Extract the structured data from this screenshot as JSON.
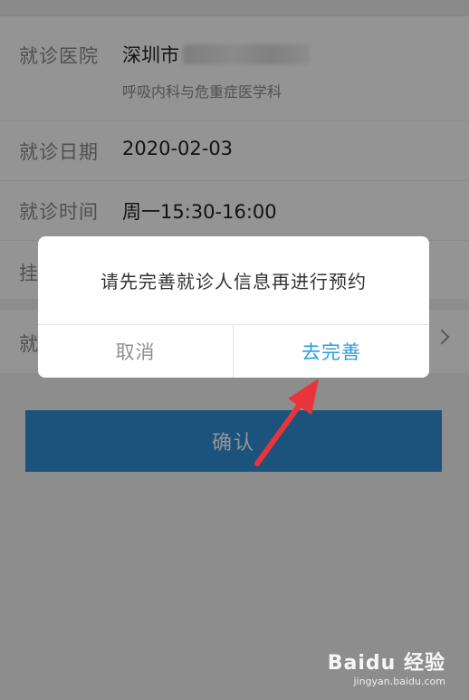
{
  "appointment": {
    "hospital_label": "就诊医院",
    "hospital_value": "深圳市",
    "department": "呼吸内科与危重症医学科",
    "date_label": "就诊日期",
    "date_value": "2020-02-03",
    "time_label": "就诊时间",
    "time_value": "周一15:30-16:00",
    "registration_label": "挂",
    "patient_label": "就"
  },
  "confirm_label": "确认",
  "dialog": {
    "message": "请先完善就诊人信息再进行预约",
    "cancel_label": "取消",
    "complete_label": "去完善"
  },
  "watermark": {
    "logo": "Baidu 经验",
    "url": "jingyan.baidu.com"
  },
  "colors": {
    "confirm_button": "#2f8fd6",
    "dialog_action": "#2d9cdb",
    "arrow": "#e8343a"
  },
  "icons": {
    "chevron": "chevron-right-icon",
    "arrow": "red-arrow-annotation"
  }
}
